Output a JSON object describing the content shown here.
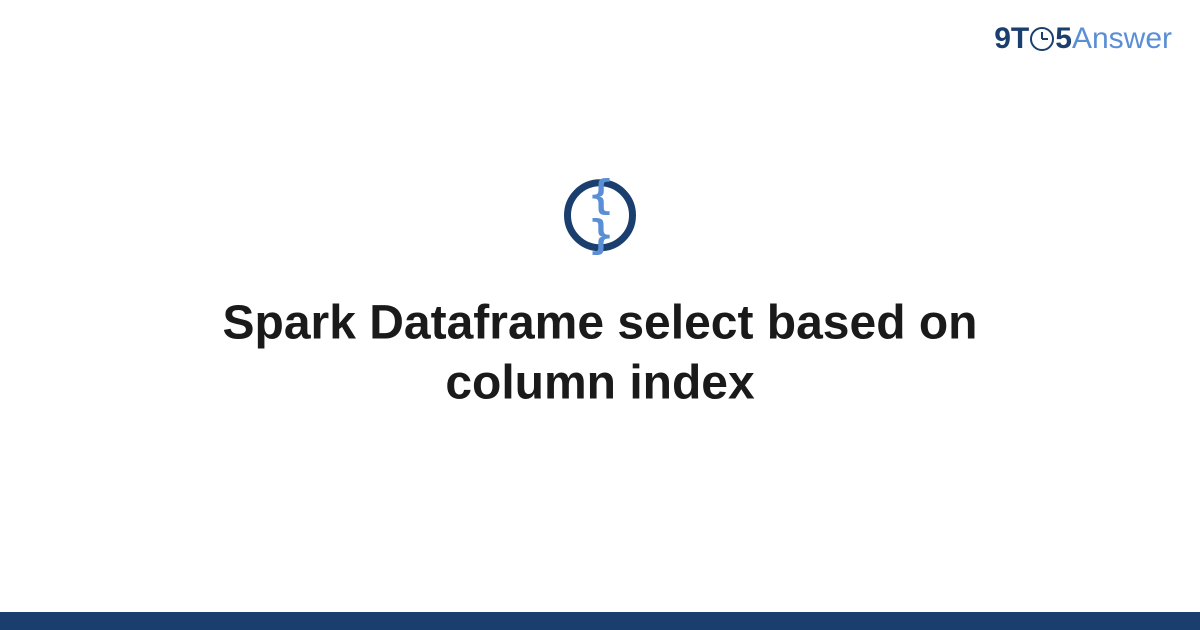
{
  "logo": {
    "prefix": "9T",
    "suffix": "5",
    "brand": "Answer"
  },
  "icon": {
    "braces": "{ }"
  },
  "title": "Spark Dataframe select based on column index"
}
